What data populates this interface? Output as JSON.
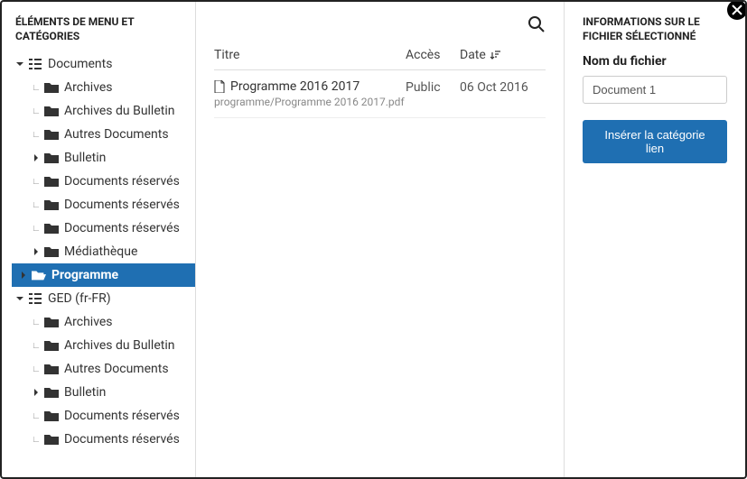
{
  "sidebar": {
    "heading": "ÉLÉMENTS DE MENU ET CATÉGORIES",
    "tree": [
      {
        "level": 0,
        "expand": "down",
        "icon": "category",
        "label": "Documents"
      },
      {
        "level": 1,
        "expand": "elbow",
        "icon": "folder",
        "label": "Archives"
      },
      {
        "level": 1,
        "expand": "elbow",
        "icon": "folder",
        "label": "Archives du Bulletin"
      },
      {
        "level": 1,
        "expand": "elbow",
        "icon": "folder",
        "label": "Autres Documents"
      },
      {
        "level": 1,
        "expand": "right",
        "icon": "folder",
        "label": "Bulletin"
      },
      {
        "level": 1,
        "expand": "elbow",
        "icon": "folder",
        "label": "Documents réservés"
      },
      {
        "level": 1,
        "expand": "elbow",
        "icon": "folder",
        "label": "Documents réservés"
      },
      {
        "level": 1,
        "expand": "elbow",
        "icon": "folder",
        "label": "Documents réservés"
      },
      {
        "level": 1,
        "expand": "right",
        "icon": "folder",
        "label": "Médiathèque"
      },
      {
        "level": 1,
        "expand": "right",
        "icon": "folder-open",
        "label": "Programme",
        "selected": true
      },
      {
        "level": 0,
        "expand": "down",
        "icon": "category",
        "label": "GED (fr-FR)"
      },
      {
        "level": 1,
        "expand": "elbow",
        "icon": "folder",
        "label": "Archives"
      },
      {
        "level": 1,
        "expand": "elbow",
        "icon": "folder",
        "label": "Archives du Bulletin"
      },
      {
        "level": 1,
        "expand": "elbow",
        "icon": "folder",
        "label": "Autres Documents"
      },
      {
        "level": 1,
        "expand": "right",
        "icon": "folder",
        "label": "Bulletin"
      },
      {
        "level": 1,
        "expand": "elbow",
        "icon": "folder",
        "label": "Documents réservés"
      },
      {
        "level": 1,
        "expand": "elbow",
        "icon": "folder",
        "label": "Documents réservés"
      }
    ]
  },
  "table": {
    "headers": {
      "title": "Titre",
      "access": "Accès",
      "date": "Date"
    },
    "rows": [
      {
        "title": "Programme 2016 2017",
        "path": "programme/Programme 2016 2017.pdf",
        "access": "Public",
        "date": "06 Oct 2016"
      }
    ]
  },
  "details": {
    "heading": "INFORMATIONS SUR LE FICHIER SÉLECTIONNÉ",
    "filename_label": "Nom du fichier",
    "filename_value": "Document 1",
    "insert_button": "Insérer la catégorie lien"
  }
}
